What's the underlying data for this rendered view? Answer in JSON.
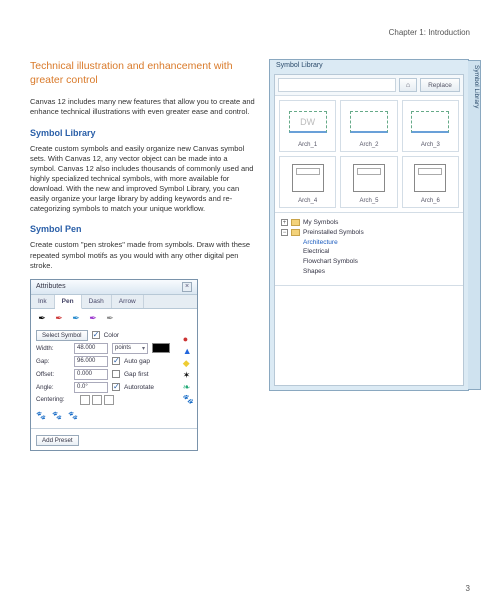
{
  "chapter_header": "Chapter 1: Introduction",
  "page_number": "3",
  "section_title": "Technical illustration and enhancement with greater control",
  "intro_para": "Canvas 12 includes many new features that allow you to create and enhance technical illustrations with even greater ease and control.",
  "sub1_title": "Symbol Library",
  "sub1_para": "Create custom symbols and easily organize new Canvas symbol sets. With Canvas 12, any vector object can be made into a symbol. Canvas 12 also includes thousands of commonly used and highly specialized technical symbols, with more available for download. With the new and improved Symbol Library, you can easily organize your large library by adding keywords and re-categorizing symbols to match your unique workflow.",
  "sub2_title": "Symbol Pen",
  "sub2_para": "Create custom \"pen strokes\" made from symbols. Draw with these repeated symbol motifs as you would with any other digital pen stroke.",
  "symlib": {
    "title": "Symbol Library",
    "side_tab": "Symbol Library",
    "replace": "Replace",
    "home_glyph": "⌂",
    "cells": [
      "Arch_1",
      "Arch_2",
      "Arch_3",
      "Arch_4",
      "Arch_5",
      "Arch_6"
    ],
    "dw_text": "DW",
    "tree": {
      "my_symbols": "My Symbols",
      "preinstalled": "Preinstalled Symbols",
      "architecture": "Architecture",
      "electrical": "Electrical",
      "flowchart": "Flowchart Symbols",
      "shapes": "Shapes"
    }
  },
  "attr": {
    "title": "Attributes",
    "tabs": {
      "ink": "Ink",
      "pen": "Pen",
      "dash": "Dash",
      "arrow": "Arrow"
    },
    "select_symbol": "Select Symbol",
    "color_label": "Color",
    "width_label": "Width:",
    "width_value": "48.000",
    "units": "points",
    "gap_label": "Gap:",
    "gap_value": "96.000",
    "autogap_label": "Auto gap",
    "offset_label": "Offset:",
    "offset_value": "0.000",
    "gapfirst_label": "Gap first",
    "angle_label": "Angle:",
    "angle_value": "0.0°",
    "autorotate_label": "Autorotate",
    "centering_label": "Centering:",
    "add_preset": "Add Preset"
  }
}
